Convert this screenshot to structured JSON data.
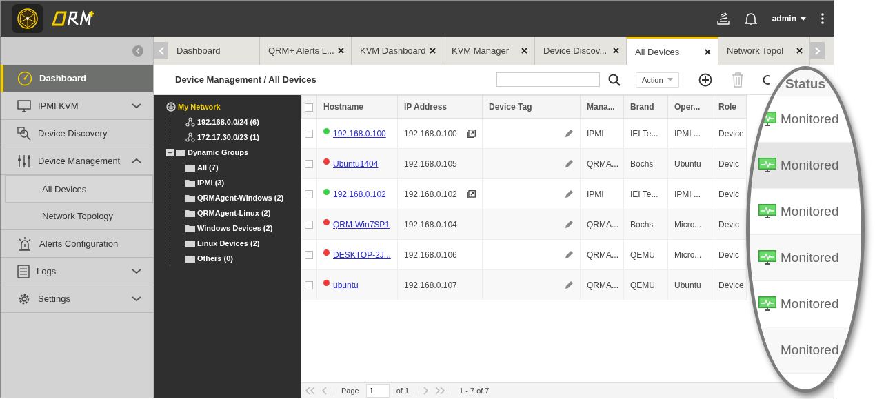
{
  "header": {
    "user": "admin"
  },
  "sidebar": {
    "items": [
      {
        "label": "Dashboard",
        "selected": true
      },
      {
        "label": "IPMI KVM",
        "selected": false,
        "expanded": false
      },
      {
        "label": "Device Discovery",
        "selected": false
      },
      {
        "label": "Device Management",
        "selected": false,
        "expanded": true,
        "children": [
          {
            "label": "All Devices",
            "selected": true
          },
          {
            "label": "Network Topology",
            "selected": false
          }
        ]
      },
      {
        "label": "Alerts Configuration",
        "selected": false
      },
      {
        "label": "Logs",
        "selected": false,
        "expanded": false
      },
      {
        "label": "Settings",
        "selected": false,
        "expanded": false
      }
    ]
  },
  "tabs": [
    {
      "label": "Dashboard",
      "closable": false,
      "selected": false
    },
    {
      "label": "QRM+ Alerts L...",
      "closable": true,
      "selected": false
    },
    {
      "label": "KVM Dashboard",
      "closable": true,
      "selected": false
    },
    {
      "label": "KVM Manager",
      "closable": true,
      "selected": false
    },
    {
      "label": "Device Discov...",
      "closable": true,
      "selected": false
    },
    {
      "label": "All Devices",
      "closable": true,
      "selected": true
    },
    {
      "label": "Network Topol",
      "closable": true,
      "selected": false
    }
  ],
  "toolbar": {
    "breadcrumb": "Device Management / All Devices",
    "action": "Action"
  },
  "tree": [
    {
      "label": "My Network",
      "selected": true,
      "children": [
        {
          "label": "192.168.0.0/24 (6)",
          "selected": false
        },
        {
          "label": "172.17.30.0/23 (1)",
          "selected": false
        }
      ]
    },
    {
      "label": "Dynamic Groups",
      "selected": false,
      "expanded": true,
      "children": [
        {
          "label": "All (7)",
          "selected": false
        },
        {
          "label": "IPMI (3)",
          "selected": false
        },
        {
          "label": "QRMAgent-Windows (2)",
          "selected": false
        },
        {
          "label": "QRMAgent-Linux (2)",
          "selected": false
        },
        {
          "label": "Windows Devices (2)",
          "selected": false
        },
        {
          "label": "Linux Devices (2)",
          "selected": false
        },
        {
          "label": "Others (0)",
          "selected": false
        }
      ]
    }
  ],
  "table": {
    "all_checked": false,
    "columns": [
      "Hostname",
      "IP Address",
      "Device Tag",
      "Mana...",
      "Brand",
      "Oper...",
      "Role"
    ],
    "rows": [
      {
        "checked": false,
        "color": "#3ecf4a",
        "hostname": "192.168.0.100",
        "ip": "192.168.0.100",
        "link": true,
        "manager": "IPMI",
        "brand": "IEI Te...",
        "os": "IPMI ...",
        "role": "Device"
      },
      {
        "checked": false,
        "color": "#f03a3a",
        "hostname": "Ubuntu1404",
        "ip": "192.168.0.105",
        "link": false,
        "manager": "QRMA...",
        "brand": "Bochs",
        "os": "Ubuntu",
        "role": "Devic"
      },
      {
        "checked": false,
        "color": "#3ecf4a",
        "hostname": "192.168.0.102",
        "ip": "192.168.0.102",
        "link": true,
        "manager": "IPMI",
        "brand": "IEI Te...",
        "os": "IPMI ...",
        "role": "Devic"
      },
      {
        "checked": false,
        "color": "#f03a3a",
        "hostname": "QRM-Win7SP1",
        "ip": "192.168.0.104",
        "link": false,
        "manager": "QRMA...",
        "brand": "Bochs",
        "os": "Micro...",
        "role": "Devic"
      },
      {
        "checked": false,
        "color": "#f03a3a",
        "hostname": "DESKTOP-2J...",
        "ip": "192.168.0.106",
        "link": false,
        "manager": "QRMA...",
        "brand": "QEMU",
        "os": "Micro...",
        "role": "Devic"
      },
      {
        "checked": false,
        "color": "#f03a3a",
        "hostname": "ubuntu",
        "ip": "192.168.0.107",
        "link": false,
        "manager": "QRMA...",
        "brand": "QEMU",
        "os": "Ubuntu",
        "role": "Device"
      }
    ]
  },
  "pager": {
    "page_label": "Page",
    "page": "1",
    "of": "of 1",
    "range": "1 - 7 of 7"
  },
  "callout": {
    "heading": "Status",
    "rows": [
      {
        "status": "Monitored",
        "highlighted": false
      },
      {
        "status": "Monitored",
        "highlighted": true
      },
      {
        "status": "Monitored",
        "highlighted": false
      },
      {
        "status": "Monitored",
        "highlighted": false
      },
      {
        "status": "Monitored",
        "highlighted": false
      },
      {
        "status": "Monitored",
        "highlighted": false
      }
    ]
  }
}
